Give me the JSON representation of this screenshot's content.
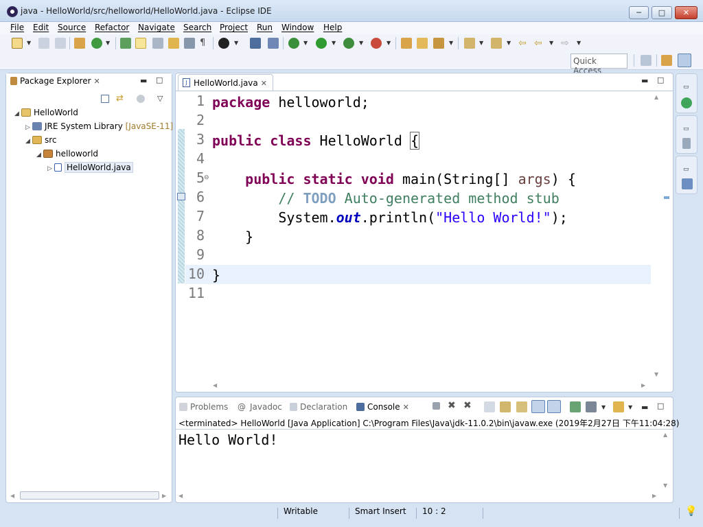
{
  "window": {
    "title": "java - HelloWorld/src/helloworld/HelloWorld.java - Eclipse IDE",
    "min": "─",
    "max": "□",
    "close": "✕"
  },
  "menu": [
    "File",
    "Edit",
    "Source",
    "Refactor",
    "Navigate",
    "Search",
    "Project",
    "Run",
    "Window",
    "Help"
  ],
  "toolbar": {
    "quick_access": "Quick Access"
  },
  "package_explorer": {
    "title": "Package Explorer",
    "tree": {
      "project": "HelloWorld",
      "jre": "JRE System Library",
      "jre_tag": "[JavaSE-11]",
      "src": "src",
      "package": "helloworld",
      "file": "HelloWorld.java"
    }
  },
  "editor": {
    "tab": "HelloWorld.java",
    "line_numbers": [
      "1",
      "2",
      "3",
      "4",
      "5",
      "6",
      "7",
      "8",
      "9",
      "10",
      "11"
    ],
    "code": {
      "l1_kw": "package",
      "l1_rest": " helloworld;",
      "l3_kw1": "public",
      "l3_kw2": "class",
      "l3_name": " HelloWorld ",
      "l3_brace": "{",
      "l5_indent": "    ",
      "l5_kw1": "public",
      "l5_kw2": "static",
      "l5_kw3": "void",
      "l5_sig": " main(String[] ",
      "l5_arg": "args",
      "l5_end": ") {",
      "l6_indent": "        ",
      "l6_slash": "// ",
      "l6_todo": "TODO",
      "l6_text": " Auto-generated method stub",
      "l7_indent": "        ",
      "l7_sys": "System.",
      "l7_out": "out",
      "l7_call": ".println(",
      "l7_str": "\"Hello World!\"",
      "l7_end": ");",
      "l8_text": "    }",
      "l10_text": "}"
    }
  },
  "console": {
    "tabs": {
      "problems": "Problems",
      "javadoc": "Javadoc",
      "declaration": "Declaration",
      "console": "Console"
    },
    "terminated": "<terminated> HelloWorld [Java Application] C:\\Program Files\\Java\\jdk-11.0.2\\bin\\javaw.exe (2019年2月27日 下午11:04:28)",
    "output": "Hello World!"
  },
  "status": {
    "writable": "Writable",
    "insert_mode": "Smart Insert",
    "position": "10 : 2"
  },
  "colors": {
    "keyword": "#7f0055",
    "comment": "#3f7f5f",
    "string": "#2a00ff",
    "field": "#0000c0"
  }
}
